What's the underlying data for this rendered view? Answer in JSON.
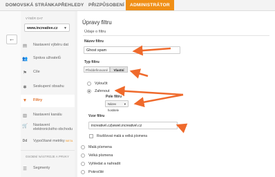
{
  "nav": {
    "tabs": [
      {
        "label": "DOMOVSKÁ STRÁNKA"
      },
      {
        "label": "PŘEHLEDY"
      },
      {
        "label": "PŘIZPŮSOBENÍ"
      },
      {
        "label": "ADMINISTRÁTOR"
      }
    ]
  },
  "sidebar": {
    "view_section_label": "VÝBĚR DAT",
    "view_selected": "www.increative.cz",
    "items": [
      {
        "label": "Nastavení výběru dat",
        "icon": "document-icon"
      },
      {
        "label": "Správa uživatelů",
        "icon": "users-icon"
      },
      {
        "label": "Cíle",
        "icon": "flag-icon"
      },
      {
        "label": "Seskupení obsahu",
        "icon": "figure-icon"
      },
      {
        "label": "Filtry",
        "icon": "funnel-icon"
      },
      {
        "label": "Nastavení kanálu",
        "icon": "channel-icon"
      },
      {
        "label": "Nastavení elektronického obchodu",
        "icon": "cart-icon"
      },
      {
        "label": "Vypočítané metriky",
        "badge": "BETA",
        "icon": "dd-icon"
      }
    ],
    "personal_section_label": "OSOBNÍ NÁSTROJE A PRVKY",
    "segments_label": "Segmenty"
  },
  "main": {
    "title": "Úpravy filtru",
    "section": "Údaje o filtru",
    "name_label": "Název filtru",
    "name_value": "Ghost spam",
    "type_label": "Typ filtru",
    "type_predefined": "Předdefinované",
    "type_custom": "Vlastní",
    "opt_exclude": "Vyloučit",
    "opt_include": "Zahrnout",
    "field_label": "Pole filtru",
    "field_value": "Název hostitele",
    "pattern_label": "Vzor filtru",
    "pattern_value": "increative\\.cz|www\\.increative\\.cz",
    "case_label": "Rozlišovat malá a velká písmena",
    "opt_lower": "Malá písmena",
    "opt_upper": "Velká písmena",
    "opt_find_replace": "Vyhledat a nahradit",
    "opt_advanced": "Pokročilé"
  },
  "colors": {
    "accent": "#f08f16",
    "arrow": "#ef6a2c"
  }
}
